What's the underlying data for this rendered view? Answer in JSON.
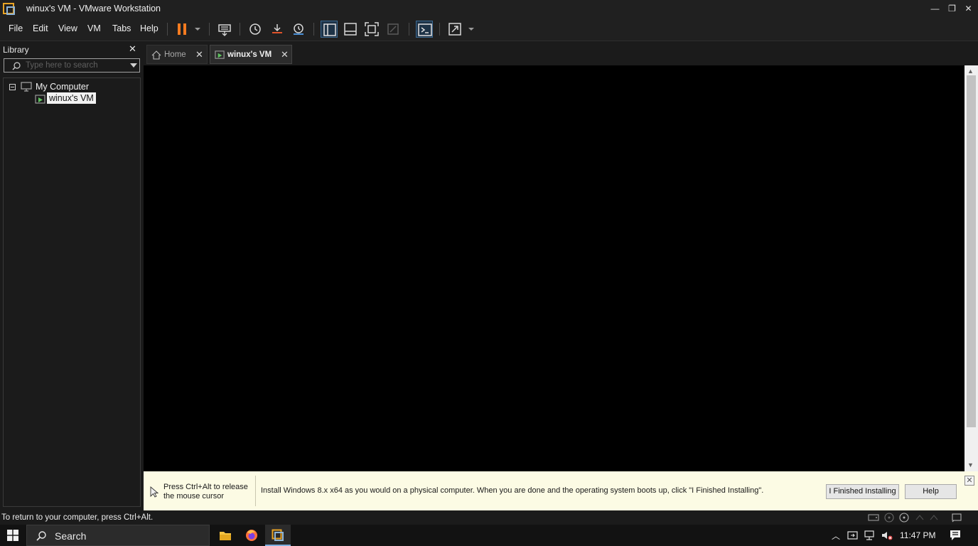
{
  "window": {
    "title": "winux's VM  - VMware Workstation",
    "minimize_glyph": "—",
    "maximize_glyph": "❐",
    "close_glyph": "✕"
  },
  "menu": {
    "items": [
      "File",
      "Edit",
      "View",
      "VM",
      "Tabs",
      "Help"
    ]
  },
  "toolbar": {
    "icons": [
      "pause-icon",
      "dropdown-icon",
      "send-ctrl-alt-del-icon",
      "snapshot-icon",
      "revert-snapshot-icon",
      "snapshot-manager-icon",
      "show-library-icon",
      "show-thumbnail-bar-icon",
      "full-screen-icon",
      "unity-icon",
      "console-view-icon",
      "stretch-guest-icon"
    ],
    "pause_color": "#f47b20"
  },
  "library": {
    "header": "Library",
    "close_glyph": "✕",
    "search_placeholder": "Type here to search",
    "tree": {
      "root_label": "My Computer",
      "child_label": "winux's VM"
    }
  },
  "tabs": [
    {
      "label": "Home",
      "close_glyph": "✕"
    },
    {
      "label": "winux's VM",
      "close_glyph": "✕"
    }
  ],
  "hint_bar": {
    "release_line1": "Press Ctrl+Alt to release",
    "release_line2": "the mouse cursor",
    "message": "Install Windows 8.x x64 as you would on a physical computer. When you are done and the operating system boots up, click \"I Finished Installing\".",
    "finished_button": "I Finished Installing",
    "help_button": "Help",
    "close_glyph": "✕"
  },
  "status_bar": {
    "text": "To return to your computer, press Ctrl+Alt."
  },
  "taskbar": {
    "search_label": "Search",
    "clock": "11:47 PM",
    "accent_color": "#7fb0e0"
  }
}
